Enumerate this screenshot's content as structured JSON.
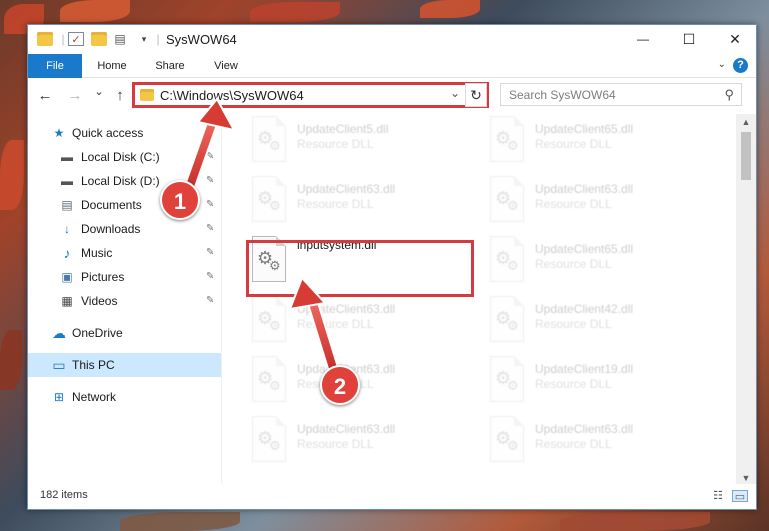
{
  "window": {
    "title": "SysWOW64",
    "minimize_glyph": "—",
    "maximize_glyph": "☐",
    "close_glyph": "✕"
  },
  "ribbon": {
    "tabs": [
      {
        "label": "File"
      },
      {
        "label": "Home"
      },
      {
        "label": "Share"
      },
      {
        "label": "View"
      }
    ],
    "help_glyph": "?"
  },
  "nav": {
    "back_glyph": "←",
    "forward_glyph": "→",
    "recent_glyph": "⌄",
    "up_glyph": "↑"
  },
  "address": {
    "path": "C:\\Windows\\SysWOW64",
    "dropdown_glyph": "⌄",
    "refresh_glyph": "↻"
  },
  "search": {
    "placeholder": "Search SysWOW64",
    "icon_glyph": "⚲"
  },
  "sidebar": {
    "items": [
      {
        "label": "Quick access",
        "icon": "star-icon",
        "glyph": "★",
        "color": "#1979ca",
        "pinned": false
      },
      {
        "label": "Local Disk (C:)",
        "icon": "drive-icon",
        "glyph": "▬",
        "color": "#555555",
        "pinned": true
      },
      {
        "label": "Local Disk (D:)",
        "icon": "drive-icon",
        "glyph": "▬",
        "color": "#555555",
        "pinned": true
      },
      {
        "label": "Documents",
        "icon": "document-icon",
        "glyph": "▤",
        "color": "#5a6b7b",
        "pinned": true
      },
      {
        "label": "Downloads",
        "icon": "download-icon",
        "glyph": "↓",
        "color": "#1979ca",
        "pinned": true
      },
      {
        "label": "Music",
        "icon": "music-icon",
        "glyph": "♪",
        "color": "#1979ca",
        "pinned": true
      },
      {
        "label": "Pictures",
        "icon": "picture-icon",
        "glyph": "▣",
        "color": "#4a7aa8",
        "pinned": true
      },
      {
        "label": "Videos",
        "icon": "video-icon",
        "glyph": "▦",
        "color": "#444444",
        "pinned": true
      },
      {
        "label": "OneDrive",
        "icon": "cloud-icon",
        "glyph": "☁",
        "color": "#1979ca",
        "pinned": false
      },
      {
        "label": "This PC",
        "icon": "computer-icon",
        "glyph": "▭",
        "color": "#1979ca",
        "pinned": false
      },
      {
        "label": "Network",
        "icon": "network-icon",
        "glyph": "⊞",
        "color": "#1979ca",
        "pinned": false
      }
    ],
    "selected": "This PC",
    "pin_glyph": "📌"
  },
  "files": {
    "left_column": [
      {
        "name": "UpdateClient5.dll",
        "type": "Resource DLL"
      },
      {
        "name": "UpdateClient63.dll",
        "type": "Resource DLL"
      },
      {
        "name": "inputsystem.dll",
        "type": ""
      },
      {
        "name": "UpdateClient63.dll",
        "type": "Resource DLL"
      },
      {
        "name": "UpdateClient63.dll",
        "type": "Resource DLL"
      },
      {
        "name": "UpdateClient63.dll",
        "type": "Resource DLL"
      }
    ],
    "right_column": [
      {
        "name": "UpdateClient65.dll",
        "type": "Resource DLL"
      },
      {
        "name": "UpdateClient63.dll",
        "type": "Resource DLL"
      },
      {
        "name": "UpdateClient65.dll",
        "type": "Resource DLL"
      },
      {
        "name": "UpdateClient42.dll",
        "type": "Resource DLL"
      },
      {
        "name": "UpdateClient19.dll",
        "type": "Resource DLL"
      },
      {
        "name": "UpdateClient63.dll",
        "type": "Resource DLL"
      }
    ],
    "highlighted": "inputsystem.dll"
  },
  "status": {
    "item_count": "182 items"
  },
  "annotations": {
    "step1": "1",
    "step2": "2",
    "highlight_color": "#d6393f"
  }
}
